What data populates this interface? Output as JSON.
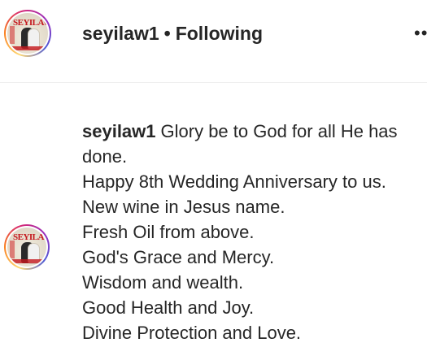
{
  "post_header": {
    "username": "seyilaw1",
    "separator": "•",
    "follow_status": "Following",
    "more_icon": "more-horizontal-icon",
    "avatar_text": "SEYILAW"
  },
  "caption": {
    "username": "seyilaw1",
    "first_line": "Glory be to God for all He has",
    "lines": [
      "done.",
      "Happy 8th Wedding Anniversary to us.",
      "New wine in Jesus name.",
      "Fresh Oil from above.",
      "God's Grace and Mercy.",
      "Wisdom and wealth.",
      "Good Health and Joy.",
      "Divine Protection and Love."
    ],
    "avatar_text": "SEYILAW"
  },
  "colors": {
    "text": "#262626",
    "divider": "#efefef",
    "story_ring": [
      "#feda75",
      "#fa7e1e",
      "#d62976",
      "#962fbf",
      "#4f5bd5"
    ],
    "magazine_red": "#c4161c"
  }
}
